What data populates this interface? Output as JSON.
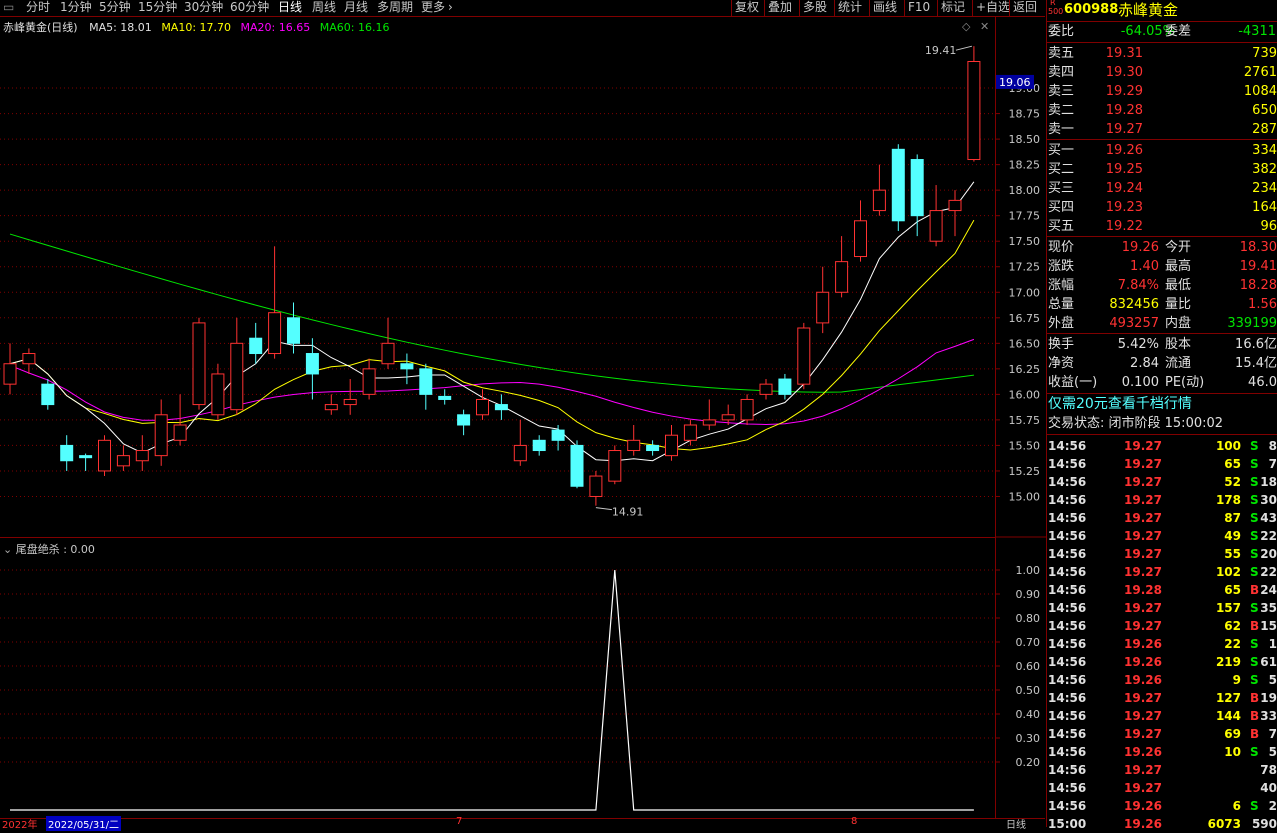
{
  "toolbar": {
    "periods": [
      "分时",
      "1分钟",
      "5分钟",
      "15分钟",
      "30分钟",
      "60分钟",
      "日线",
      "周线",
      "月线",
      "多周期",
      "更多"
    ],
    "active_period": "日线",
    "right_buttons": [
      "复权",
      "叠加",
      "多股",
      "统计",
      "画线",
      "F10",
      "标记",
      "+自选",
      "返回"
    ]
  },
  "main_legend": {
    "title": "赤峰黄金(日线)",
    "ma5": "MA5: 18.01",
    "ma10": "MA10: 17.70",
    "ma20": "MA20: 16.65",
    "ma60": "MA60: 16.16"
  },
  "indicator_legend": {
    "title": "尾盘绝杀 : 0.00"
  },
  "annotations": {
    "high_label": "19.41",
    "low_label": "14.91"
  },
  "price_axis": {
    "current_price_tag": "19.06",
    "ticks": [
      "19.00",
      "18.75",
      "18.50",
      "18.25",
      "18.00",
      "17.75",
      "17.50",
      "17.25",
      "17.00",
      "16.75",
      "16.50",
      "16.25",
      "16.00",
      "15.75",
      "15.50",
      "15.25",
      "15.00"
    ]
  },
  "indicator_axis": {
    "ticks": [
      "1.00",
      "0.90",
      "0.80",
      "0.70",
      "0.60",
      "0.50",
      "0.40",
      "0.30",
      "0.20"
    ]
  },
  "x_axis": {
    "labels": [
      "2022年",
      "2022/05/31/二",
      "7",
      "8"
    ],
    "period_label": "日线"
  },
  "colors": {
    "up": "#ff3232",
    "down": "#54ffff",
    "ma5": "#ffffff",
    "ma10": "#ffff00",
    "ma20": "#ff00ff",
    "ma60": "#00e600",
    "grid": "#800000"
  },
  "chart_data": {
    "type": "candlestick",
    "ylim": [
      14.75,
      19.5
    ],
    "candles": [
      [
        16.1,
        16.3,
        16.5,
        16.0
      ],
      [
        16.3,
        16.4,
        16.45,
        16.2
      ],
      [
        16.1,
        15.9,
        16.15,
        15.85
      ],
      [
        15.5,
        15.35,
        15.6,
        15.25
      ],
      [
        15.4,
        15.38,
        15.42,
        15.25
      ],
      [
        15.25,
        15.55,
        15.6,
        15.2
      ],
      [
        15.3,
        15.4,
        15.5,
        15.25
      ],
      [
        15.35,
        15.45,
        15.6,
        15.25
      ],
      [
        15.4,
        15.8,
        15.95,
        15.3
      ],
      [
        15.55,
        15.7,
        16.0,
        15.5
      ],
      [
        15.9,
        16.7,
        16.75,
        15.85
      ],
      [
        15.8,
        16.2,
        16.3,
        15.75
      ],
      [
        15.85,
        16.5,
        16.75,
        15.8
      ],
      [
        16.55,
        16.4,
        16.7,
        16.3
      ],
      [
        16.4,
        16.8,
        17.45,
        16.35
      ],
      [
        16.75,
        16.5,
        16.9,
        16.4
      ],
      [
        16.4,
        16.2,
        16.55,
        15.95
      ],
      [
        15.85,
        15.9,
        16.0,
        15.8
      ],
      [
        15.9,
        15.95,
        16.15,
        15.8
      ],
      [
        16.0,
        16.25,
        16.35,
        15.95
      ],
      [
        16.3,
        16.5,
        16.75,
        16.25
      ],
      [
        16.3,
        16.25,
        16.4,
        16.1
      ],
      [
        16.25,
        16.0,
        16.3,
        15.85
      ],
      [
        15.98,
        15.95,
        16.05,
        15.9
      ],
      [
        15.8,
        15.7,
        15.85,
        15.6
      ],
      [
        15.8,
        15.95,
        16.05,
        15.75
      ],
      [
        15.9,
        15.85,
        16.0,
        15.75
      ],
      [
        15.35,
        15.5,
        15.75,
        15.3
      ],
      [
        15.55,
        15.45,
        15.6,
        15.4
      ],
      [
        15.65,
        15.55,
        15.7,
        15.45
      ],
      [
        15.5,
        15.1,
        15.55,
        15.08
      ],
      [
        15.0,
        15.2,
        15.25,
        14.91
      ],
      [
        15.15,
        15.45,
        15.5,
        15.12
      ],
      [
        15.45,
        15.55,
        15.7,
        15.4
      ],
      [
        15.5,
        15.45,
        15.55,
        15.4
      ],
      [
        15.4,
        15.6,
        15.7,
        15.35
      ],
      [
        15.55,
        15.7,
        15.75,
        15.5
      ],
      [
        15.7,
        15.75,
        15.95,
        15.65
      ],
      [
        15.75,
        15.8,
        15.9,
        15.7
      ],
      [
        15.75,
        15.95,
        16.0,
        15.7
      ],
      [
        16.0,
        16.1,
        16.15,
        15.95
      ],
      [
        16.15,
        16.0,
        16.2,
        15.95
      ],
      [
        16.1,
        16.65,
        16.7,
        16.05
      ],
      [
        16.7,
        17.0,
        17.25,
        16.6
      ],
      [
        17.0,
        17.3,
        17.55,
        16.95
      ],
      [
        17.35,
        17.7,
        17.9,
        17.3
      ],
      [
        17.8,
        18.0,
        18.25,
        17.75
      ],
      [
        18.4,
        17.7,
        18.45,
        17.6
      ],
      [
        18.3,
        17.75,
        18.35,
        17.55
      ],
      [
        17.5,
        17.8,
        18.05,
        17.45
      ],
      [
        17.8,
        17.9,
        18.0,
        17.55
      ],
      [
        18.3,
        19.26,
        19.41,
        18.28
      ]
    ],
    "indicator": {
      "name": "尾盘绝杀",
      "values": [
        0,
        0,
        0,
        0,
        0,
        0,
        0,
        0,
        0,
        0,
        0,
        0,
        0,
        0,
        0,
        0,
        0,
        0,
        0,
        0,
        0,
        0,
        0,
        0,
        0,
        0,
        0,
        0,
        0,
        0,
        0,
        0,
        1,
        0,
        0,
        0,
        0,
        0,
        0,
        0,
        0,
        0,
        0,
        0,
        0,
        0,
        0,
        0,
        0,
        0,
        0,
        0
      ],
      "ylim": [
        0,
        1.05
      ]
    }
  },
  "panel": {
    "code": "600988",
    "name": "赤峰黄金",
    "badge_top": "R",
    "badge_bottom": "500",
    "weibi_label": "委比",
    "weibi_value": "-64.05%",
    "weicha_label": "委差",
    "weicha_value": "-4311",
    "asks": [
      {
        "label": "卖五",
        "price": "19.31",
        "vol": "739"
      },
      {
        "label": "卖四",
        "price": "19.30",
        "vol": "2761"
      },
      {
        "label": "卖三",
        "price": "19.29",
        "vol": "1084"
      },
      {
        "label": "卖二",
        "price": "19.28",
        "vol": "650"
      },
      {
        "label": "卖一",
        "price": "19.27",
        "vol": "287"
      }
    ],
    "bids": [
      {
        "label": "买一",
        "price": "19.26",
        "vol": "334"
      },
      {
        "label": "买二",
        "price": "19.25",
        "vol": "382"
      },
      {
        "label": "买三",
        "price": "19.24",
        "vol": "234"
      },
      {
        "label": "买四",
        "price": "19.23",
        "vol": "164"
      },
      {
        "label": "买五",
        "price": "19.22",
        "vol": "96"
      }
    ],
    "stats": [
      {
        "l1": "现价",
        "v1": "19.26",
        "c1": "red",
        "l2": "今开",
        "v2": "18.30",
        "c2": "red"
      },
      {
        "l1": "涨跌",
        "v1": "1.40",
        "c1": "red",
        "l2": "最高",
        "v2": "19.41",
        "c2": "red"
      },
      {
        "l1": "涨幅",
        "v1": "7.84%",
        "c1": "red",
        "l2": "最低",
        "v2": "18.28",
        "c2": "red"
      },
      {
        "l1": "总量",
        "v1": "832456",
        "c1": "yellow",
        "l2": "量比",
        "v2": "1.56",
        "c2": "red"
      },
      {
        "l1": "外盘",
        "v1": "493257",
        "c1": "red",
        "l2": "内盘",
        "v2": "339199",
        "c2": "green"
      }
    ],
    "stats2": [
      {
        "l1": "换手",
        "v1": "5.42%",
        "l2": "股本",
        "v2": "16.6亿"
      },
      {
        "l1": "净资",
        "v1": "2.84",
        "l2": "流通",
        "v2": "15.4亿"
      },
      {
        "l1": "收益(一)",
        "v1": "0.100",
        "l2": "PE(动)",
        "v2": "46.0"
      }
    ],
    "promo": "仅需20元查看千档行情",
    "status": "交易状态: 闭市阶段 15:00:02",
    "ticks": [
      {
        "t": "14:56",
        "p": "19.27",
        "v": "100",
        "s": "S",
        "n": "8"
      },
      {
        "t": "14:56",
        "p": "19.27",
        "v": "65",
        "s": "S",
        "n": "7"
      },
      {
        "t": "14:56",
        "p": "19.27",
        "v": "52",
        "s": "S",
        "n": "18"
      },
      {
        "t": "14:56",
        "p": "19.27",
        "v": "178",
        "s": "S",
        "n": "30"
      },
      {
        "t": "14:56",
        "p": "19.27",
        "v": "87",
        "s": "S",
        "n": "43"
      },
      {
        "t": "14:56",
        "p": "19.27",
        "v": "49",
        "s": "S",
        "n": "22"
      },
      {
        "t": "14:56",
        "p": "19.27",
        "v": "55",
        "s": "S",
        "n": "20"
      },
      {
        "t": "14:56",
        "p": "19.27",
        "v": "102",
        "s": "S",
        "n": "22"
      },
      {
        "t": "14:56",
        "p": "19.28",
        "v": "65",
        "s": "B",
        "n": "24"
      },
      {
        "t": "14:56",
        "p": "19.27",
        "v": "157",
        "s": "S",
        "n": "35"
      },
      {
        "t": "14:56",
        "p": "19.27",
        "v": "62",
        "s": "B",
        "n": "15"
      },
      {
        "t": "14:56",
        "p": "19.26",
        "v": "22",
        "s": "S",
        "n": "1"
      },
      {
        "t": "14:56",
        "p": "19.26",
        "v": "219",
        "s": "S",
        "n": "61"
      },
      {
        "t": "14:56",
        "p": "19.26",
        "v": "9",
        "s": "S",
        "n": "5"
      },
      {
        "t": "14:56",
        "p": "19.27",
        "v": "127",
        "s": "B",
        "n": "19"
      },
      {
        "t": "14:56",
        "p": "19.27",
        "v": "144",
        "s": "B",
        "n": "33"
      },
      {
        "t": "14:56",
        "p": "19.27",
        "v": "69",
        "s": "B",
        "n": "7"
      },
      {
        "t": "14:56",
        "p": "19.26",
        "v": "10",
        "s": "S",
        "n": "5"
      },
      {
        "t": "14:56",
        "p": "19.27",
        "v": "",
        "s": "",
        "n": "78"
      },
      {
        "t": "14:56",
        "p": "19.27",
        "v": "",
        "s": "",
        "n": "40"
      },
      {
        "t": "14:56",
        "p": "19.26",
        "v": "6",
        "s": "S",
        "n": "2"
      },
      {
        "t": "15:00",
        "p": "19.26",
        "v": "6073",
        "s": "",
        "n": "590"
      }
    ]
  }
}
